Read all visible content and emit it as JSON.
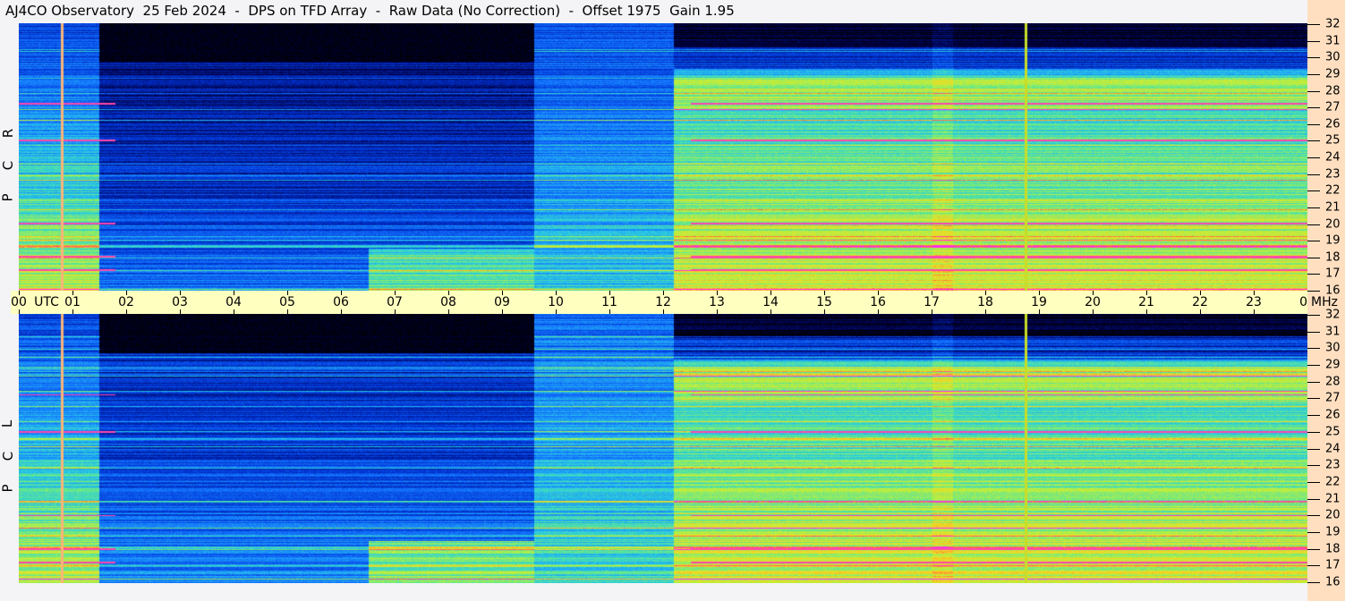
{
  "title": "AJ4CO Observatory  25 Feb 2024  -  DPS on TFD Array  -  Raw Data (No Correction)  -  Offset 1975  Gain 1.95",
  "chart_data": {
    "type": "heatmap",
    "title": "AJ4CO Observatory 25 Feb 2024 - DPS on TFD Array - Raw Data (No Correction) - Offset 1975 Gain 1.95",
    "xlabel": "UTC",
    "ylabel": "MHz",
    "x_ticks": [
      "00",
      "01",
      "02",
      "03",
      "04",
      "05",
      "06",
      "07",
      "08",
      "09",
      "10",
      "11",
      "12",
      "13",
      "14",
      "15",
      "16",
      "17",
      "18",
      "19",
      "20",
      "21",
      "22",
      "23",
      "00"
    ],
    "x_range_hours": [
      0,
      24
    ],
    "y_ticks": [
      "32",
      "31",
      "30",
      "29",
      "28",
      "27",
      "26",
      "25",
      "24",
      "23",
      "22",
      "21",
      "20",
      "19",
      "18",
      "17",
      "16"
    ],
    "y_range_mhz": [
      16,
      32
    ],
    "panels": [
      {
        "name": "RCP",
        "letters": [
          "R",
          "C",
          "P"
        ]
      },
      {
        "name": "LCP",
        "letters": [
          "L",
          "C",
          "P"
        ]
      }
    ],
    "x_axis_unit_label": "UTC",
    "y_axis_unit_label": "MHz",
    "features": {
      "night_quiet_hours": [
        1.5,
        9.6
      ],
      "bright_band_hours": [
        9.6,
        12.2
      ],
      "marker_lines_hours": [
        0.8,
        18.75
      ],
      "interference_mhz": [
        25,
        20,
        18,
        17.2,
        27.2
      ]
    }
  }
}
